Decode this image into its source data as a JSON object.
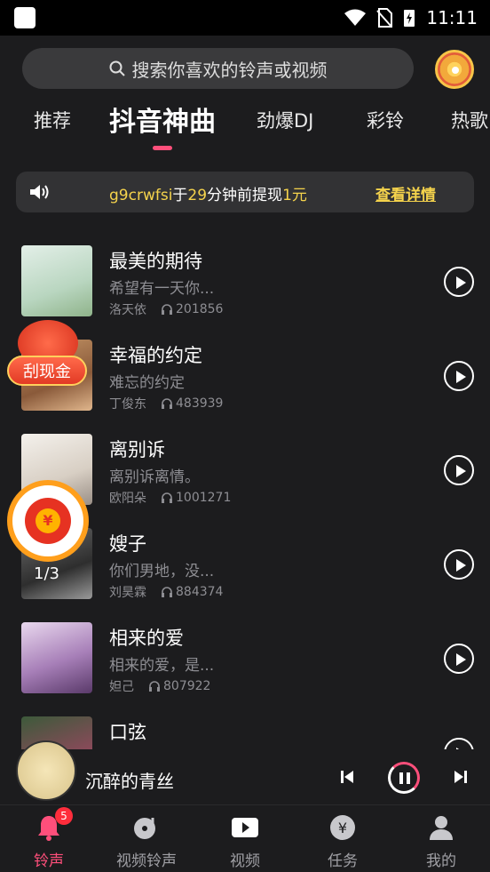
{
  "status": {
    "time": "11:11"
  },
  "search": {
    "placeholder": "搜索你喜欢的铃声或视频"
  },
  "tabs": [
    "推荐",
    "抖音神曲",
    "劲爆DJ",
    "彩铃",
    "热歌"
  ],
  "notice": {
    "user": "g9crwfsi",
    "text1": "于",
    "minutes": "29",
    "text2": "分钟前提现",
    "amount": "1元",
    "detail": "查看详情"
  },
  "songs": [
    {
      "title": "最美的期待",
      "desc": "希望有一天你...",
      "artist": "洛天依",
      "plays": "201856"
    },
    {
      "title": "幸福的约定",
      "desc": "难忘的约定",
      "artist": "丁俊东",
      "plays": "483939"
    },
    {
      "title": "离别诉",
      "desc": "离别诉离情。",
      "artist": "欧阳朵",
      "plays": "1001271"
    },
    {
      "title": "嫂子",
      "desc": "你们男地，没...",
      "artist": "刘昊霖",
      "plays": "884374"
    },
    {
      "title": "相来的爱",
      "desc": "相来的爱，是...",
      "artist": "妲己",
      "plays": "807922"
    },
    {
      "title": "口弦",
      "desc": "",
      "artist": "",
      "plays": ""
    }
  ],
  "floats": {
    "scratch": "刮现金",
    "redpack_count": "1/3"
  },
  "player": {
    "title": "沉醉的青丝"
  },
  "nav": [
    {
      "label": "铃声",
      "badge": "5",
      "icon": "bell-icon"
    },
    {
      "label": "视频铃声",
      "icon": "music-disc-icon"
    },
    {
      "label": "视频",
      "icon": "video-play-icon"
    },
    {
      "label": "任务",
      "icon": "yuan-coin-icon"
    },
    {
      "label": "我的",
      "icon": "user-icon"
    }
  ],
  "colors": {
    "accent": "#ff4f7b",
    "highlight": "#f5d34c",
    "bg": "#1c1c1e"
  }
}
